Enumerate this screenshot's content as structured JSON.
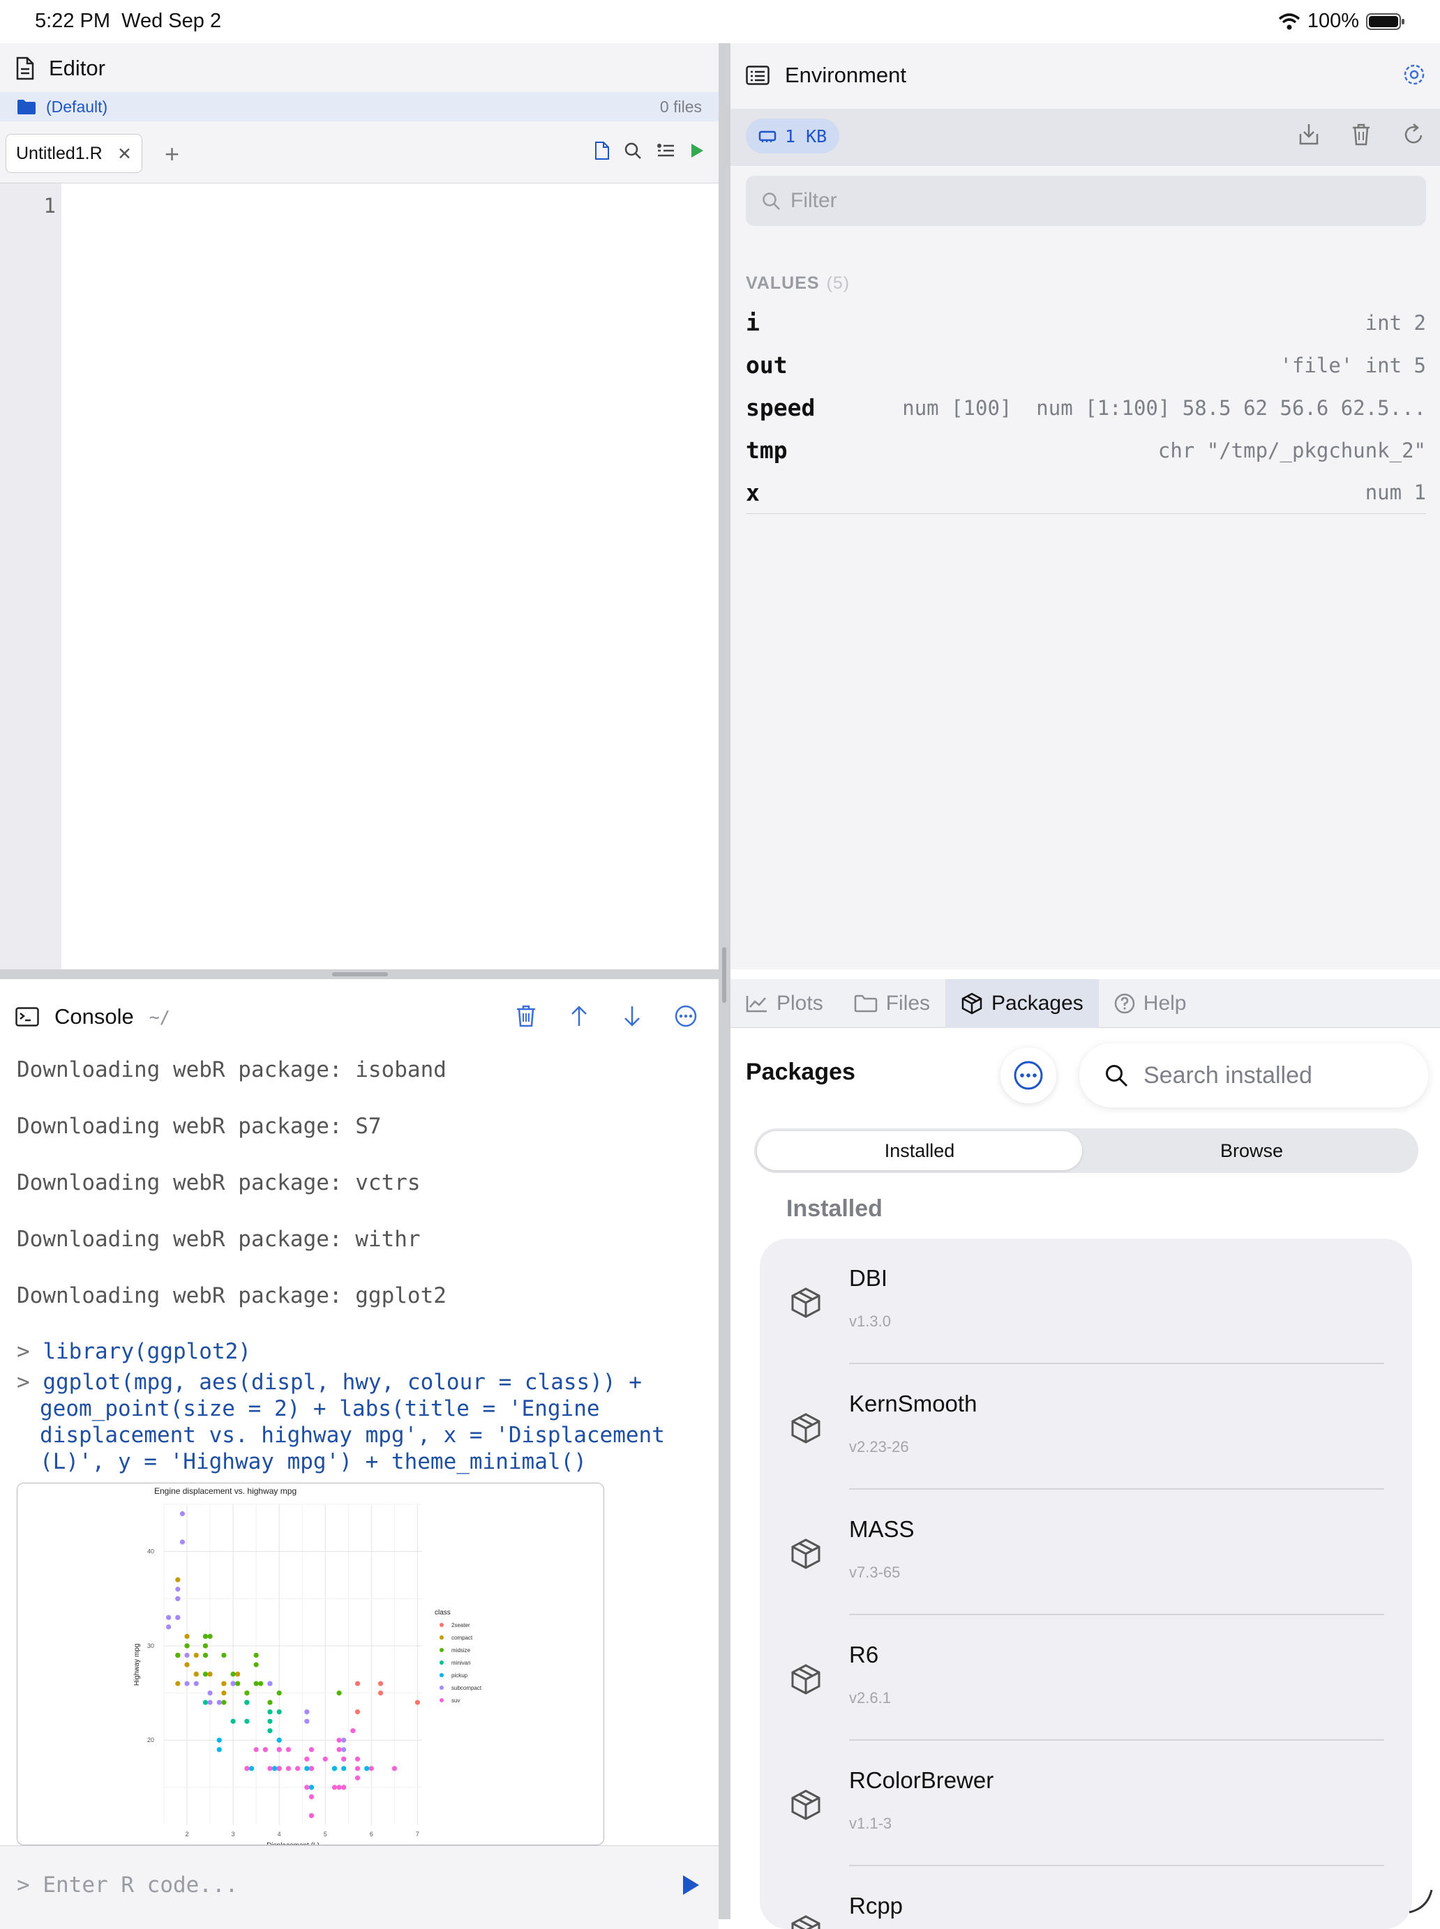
{
  "status_bar": {
    "time": "5:22 PM",
    "date": "Wed Sep 2",
    "battery": "100%"
  },
  "editor": {
    "title": "Editor",
    "project": "(Default)",
    "file_count": "0 files",
    "tab_label": "Untitled1.R",
    "line_numbers": [
      "1"
    ]
  },
  "environment": {
    "title": "Environment",
    "memory": "1 KB",
    "filter_placeholder": "Filter",
    "values_label": "VALUES",
    "values_count": "(5)",
    "variables": [
      {
        "name": "i",
        "value": "int 2"
      },
      {
        "name": "out",
        "value": "'file' int 5"
      },
      {
        "name": "speed",
        "value": "num [100]  num [1:100] 58.5 62 56.6 62.5..."
      },
      {
        "name": "tmp",
        "value": "chr \"/tmp/_pkgchunk_2\""
      },
      {
        "name": "x",
        "value": "num 1"
      }
    ]
  },
  "console": {
    "title": "Console",
    "path": "~/",
    "output": [
      "Downloading webR package: isoband",
      "Downloading webR package: S7",
      "Downloading webR package: vctrs",
      "Downloading webR package: withr",
      "Downloading webR package: ggplot2"
    ],
    "cmd1": "library(ggplot2)",
    "cmd2_l1": "ggplot(mpg, aes(displ, hwy, colour = class)) +",
    "cmd2_l2": "geom_point(size = 2) + labs(title = 'Engine",
    "cmd2_l3": "displacement vs. highway mpg', x = 'Displacement",
    "cmd2_l4": "(L)', y = 'Highway mpg') + theme_minimal()",
    "prompt": ">",
    "input_placeholder": "Enter R code..."
  },
  "chart_data": {
    "type": "scatter",
    "title": "Engine displacement vs. highway mpg",
    "xlabel": "Displacement (L)",
    "ylabel": "Highway mpg",
    "xlim": [
      1.5,
      7.1
    ],
    "ylim": [
      11,
      45
    ],
    "xticks": [
      "2",
      "3",
      "4",
      "5",
      "6",
      "7"
    ],
    "yticks": [
      "20",
      "30",
      "40"
    ],
    "grid": true,
    "legend_title": "class",
    "legend_position": "right",
    "series": [
      {
        "name": "2seater",
        "color": "#F8766D",
        "points": [
          [
            5.7,
            26
          ],
          [
            5.7,
            23
          ],
          [
            6.2,
            26
          ],
          [
            6.2,
            25
          ],
          [
            7.0,
            24
          ]
        ]
      },
      {
        "name": "compact",
        "color": "#C49A00",
        "points": [
          [
            1.8,
            29
          ],
          [
            1.8,
            29
          ],
          [
            2.0,
            31
          ],
          [
            2.0,
            30
          ],
          [
            2.8,
            26
          ],
          [
            2.8,
            26
          ],
          [
            3.1,
            27
          ],
          [
            1.8,
            26
          ],
          [
            2.0,
            28
          ],
          [
            2.8,
            25
          ],
          [
            2.4,
            31
          ],
          [
            2.2,
            27
          ],
          [
            2.4,
            30
          ],
          [
            2.2,
            29
          ],
          [
            1.8,
            33
          ],
          [
            1.8,
            35
          ],
          [
            1.8,
            37
          ],
          [
            2.0,
            28
          ],
          [
            2.4,
            29
          ],
          [
            2.5,
            27
          ],
          [
            3.0,
            26
          ],
          [
            3.3,
            25
          ],
          [
            3.1,
            26
          ],
          [
            2.2,
            27
          ]
        ]
      },
      {
        "name": "midsize",
        "color": "#53B400",
        "points": [
          [
            2.4,
            27
          ],
          [
            2.4,
            30
          ],
          [
            3.1,
            26
          ],
          [
            3.5,
            29
          ],
          [
            3.6,
            26
          ],
          [
            2.4,
            31
          ],
          [
            2.5,
            31
          ],
          [
            3.5,
            26
          ],
          [
            3.0,
            27
          ],
          [
            3.3,
            24
          ],
          [
            3.8,
            26
          ],
          [
            3.8,
            24
          ],
          [
            4.0,
            25
          ],
          [
            2.8,
            24
          ],
          [
            2.8,
            29
          ],
          [
            3.3,
            25
          ],
          [
            3.5,
            28
          ],
          [
            1.8,
            29
          ],
          [
            2.0,
            30
          ],
          [
            2.4,
            29
          ],
          [
            3.0,
            26
          ],
          [
            5.3,
            25
          ]
        ]
      },
      {
        "name": "minivan",
        "color": "#00C094",
        "points": [
          [
            2.4,
            24
          ],
          [
            3.0,
            22
          ],
          [
            3.3,
            22
          ],
          [
            3.3,
            24
          ],
          [
            3.3,
            24
          ],
          [
            3.8,
            23
          ],
          [
            4.0,
            23
          ],
          [
            3.8,
            21
          ],
          [
            3.3,
            17
          ],
          [
            3.8,
            22
          ],
          [
            4.0,
            17
          ]
        ]
      },
      {
        "name": "pickup",
        "color": "#00B6EB",
        "points": [
          [
            3.7,
            19
          ],
          [
            3.9,
            17
          ],
          [
            4.7,
            17
          ],
          [
            4.7,
            15
          ],
          [
            5.2,
            17
          ],
          [
            5.2,
            17
          ],
          [
            3.9,
            17
          ],
          [
            4.7,
            17
          ],
          [
            4.7,
            15
          ],
          [
            5.9,
            17
          ],
          [
            2.7,
            20
          ],
          [
            2.7,
            19
          ],
          [
            3.4,
            17
          ],
          [
            4.0,
            17
          ],
          [
            4.0,
            20
          ],
          [
            4.6,
            17
          ],
          [
            5.4,
            15
          ],
          [
            4.7,
            12
          ],
          [
            5.4,
            17
          ],
          [
            4.0,
            20
          ]
        ]
      },
      {
        "name": "subcompact",
        "color": "#A58AFF",
        "points": [
          [
            1.9,
            44
          ],
          [
            1.9,
            41
          ],
          [
            1.6,
            33
          ],
          [
            1.6,
            32
          ],
          [
            1.8,
            35
          ],
          [
            1.8,
            36
          ],
          [
            1.8,
            33
          ],
          [
            2.0,
            26
          ],
          [
            2.0,
            29
          ],
          [
            2.5,
            24
          ],
          [
            3.8,
            26
          ],
          [
            4.6,
            23
          ],
          [
            4.6,
            22
          ],
          [
            5.4,
            20
          ],
          [
            5.4,
            18
          ],
          [
            5.4,
            19
          ],
          [
            2.2,
            26
          ],
          [
            2.5,
            25
          ],
          [
            2.7,
            24
          ],
          [
            3.0,
            26
          ]
        ]
      },
      {
        "name": "suv",
        "color": "#FB61D7",
        "points": [
          [
            5.3,
            20
          ],
          [
            5.3,
            15
          ],
          [
            5.7,
            17
          ],
          [
            6.0,
            17
          ],
          [
            6.5,
            17
          ],
          [
            5.7,
            18
          ],
          [
            4.7,
            17
          ],
          [
            4.7,
            19
          ],
          [
            5.2,
            15
          ],
          [
            3.3,
            17
          ],
          [
            3.7,
            19
          ],
          [
            4.0,
            19
          ],
          [
            4.2,
            17
          ],
          [
            4.4,
            17
          ],
          [
            4.6,
            18
          ],
          [
            5.4,
            15
          ],
          [
            5.4,
            18
          ],
          [
            4.0,
            17
          ],
          [
            4.2,
            19
          ],
          [
            4.6,
            15
          ],
          [
            4.7,
            14
          ],
          [
            3.8,
            17
          ],
          [
            5.0,
            18
          ],
          [
            5.7,
            16
          ],
          [
            5.3,
            19
          ],
          [
            5.6,
            21
          ],
          [
            4.0,
            19
          ],
          [
            3.5,
            19
          ],
          [
            4.7,
            12
          ]
        ]
      }
    ]
  },
  "bottom_right": {
    "tabs": [
      "Plots",
      "Files",
      "Packages",
      "Help"
    ],
    "active_tab": "Packages",
    "title": "Packages",
    "search_placeholder": "Search installed",
    "segments": [
      "Installed",
      "Browse"
    ],
    "section_header": "Installed",
    "packages": [
      {
        "name": "DBI",
        "version": "v1.3.0"
      },
      {
        "name": "KernSmooth",
        "version": "v2.23-26"
      },
      {
        "name": "MASS",
        "version": "v7.3-65"
      },
      {
        "name": "R6",
        "version": "v2.6.1"
      },
      {
        "name": "RColorBrewer",
        "version": "v1.1-3"
      },
      {
        "name": "Rcpp",
        "version": ""
      }
    ]
  }
}
